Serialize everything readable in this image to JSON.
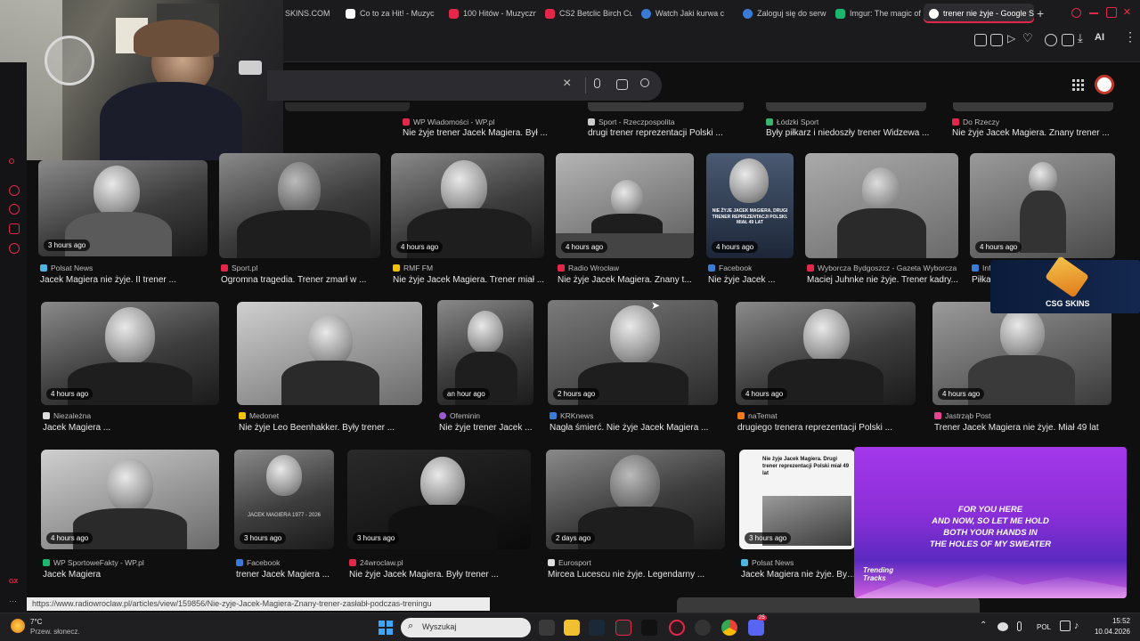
{
  "tabs": [
    {
      "label": "SKINS.COM",
      "color": "#3d3d3d"
    },
    {
      "label": "Co to za Hit! - Muzyc",
      "color": "#ffffff"
    },
    {
      "label": "100 Hitów - Muzyczn",
      "color": "#e3274a"
    },
    {
      "label": "CS2 Betclic Birch Cu",
      "color": "#e3274a"
    },
    {
      "label": "Watch Jaki kurwa c",
      "color": "#3a7bd5"
    },
    {
      "label": "Zaloguj się do serwi",
      "color": "#3a7bd5"
    },
    {
      "label": "Imgur: The magic of t",
      "color": "#1bb76e"
    },
    {
      "label": "trener nie żyje - Google Se",
      "color": "#ffffff"
    }
  ],
  "toolbar": {
    "ai_label": "AI"
  },
  "rail_labels": {
    "gx": "GX",
    "dots": "···"
  },
  "rows": [
    [
      {
        "source": "WP Wiadomości - WP.pl",
        "title": "Nie żyje trener Jacek Magiera. Był ...",
        "src_color": "#e3274a"
      },
      {
        "source": "Sport - Rzeczpospolita",
        "title": "drugi trener reprezentacji Polski ...",
        "src_color": "#cccccc"
      },
      {
        "source": "Łódzki Sport",
        "title": "Były piłkarz i niedoszły trener Widzewa ...",
        "src_color": "#3cb371"
      },
      {
        "source": "Do Rzeczy",
        "title": "Nie żyje Jacek Magiera. Znany trener ...",
        "src_color": "#e3274a"
      }
    ],
    [
      {
        "badge": "3 hours ago",
        "source": "Polsat News",
        "title": "Jacek Magiera nie żyje. II trener ...",
        "src_color": "#4fb3e0"
      },
      {
        "badge": "",
        "source": "Sport.pl",
        "title": "Ogromna tragedia. Trener zmarł w ...",
        "src_color": "#e3274a"
      },
      {
        "badge": "4 hours ago",
        "source": "RMF FM",
        "title": "Nie żyje Jacek Magiera. Trener miał ...",
        "src_color": "#f2c200"
      },
      {
        "badge": "4 hours ago",
        "source": "Radio Wrocław",
        "title": "Nie żyje Jacek Magiera. Znany t...",
        "src_color": "#e3274a"
      },
      {
        "badge": "4 hours ago",
        "source": "Facebook",
        "title": "Nie żyje Jacek ...",
        "src_color": "#3a7bd5",
        "overlay": "NIE ŻYJE JACEK MAGIERA, DRUGI TRENER REPREZENTACJI POLSKI. MIAŁ 49 LAT"
      },
      {
        "badge": "",
        "source": "Wyborcza Bydgoszcz - Gazeta Wyborcza",
        "title": "Maciej Juhnke nie żyje. Trener kadry...",
        "src_color": "#e3274a"
      },
      {
        "badge": "4 hours ago",
        "source": "Inf",
        "title": "Piłka",
        "src_color": "#3a7bd5"
      }
    ],
    [
      {
        "badge": "4 hours ago",
        "source": "Niezależna",
        "title": "Jacek Magiera ...",
        "src_color": "#dddddd"
      },
      {
        "badge": "",
        "source": "Medonet",
        "title": "Nie żyje Leo Beenhakker. Były trener ...",
        "src_color": "#f2c200"
      },
      {
        "badge": "an hour ago",
        "source": "Ofeminin",
        "title": "Nie żyje trener Jacek ...",
        "src_color": "#9b59d0"
      },
      {
        "badge": "2 hours ago",
        "source": "KRKnews",
        "title": "Nagła śmierć. Nie żyje Jacek Magiera ...",
        "src_color": "#3a7bd5"
      },
      {
        "badge": "4 hours ago",
        "source": "naTemat",
        "title": "drugiego trenera reprezentacji Polski ...",
        "src_color": "#f07a1a"
      },
      {
        "badge": "4 hours ago",
        "source": "Jastrząb Post",
        "title": "Trener Jacek Magiera nie żyje. Miał 49 lat",
        "src_color": "#e84393"
      }
    ],
    [
      {
        "badge": "4 hours ago",
        "source": "WP SportoweFakty - WP.pl",
        "title": "Jacek Magiera",
        "src_color": "#1bb76e"
      },
      {
        "badge": "3 hours ago",
        "source": "Facebook",
        "title": "trener Jacek Magiera ...",
        "src_color": "#3a7bd5",
        "overlay": "JACEK MAGIERA 1977 - 2026"
      },
      {
        "badge": "3 hours ago",
        "source": "24wroclaw.pl",
        "title": "Nie żyje Jacek Magiera. Były trener ...",
        "src_color": "#e3274a"
      },
      {
        "badge": "2 days ago",
        "source": "Eurosport",
        "title": "Mircea Lucescu nie żyje. Legendarny ...",
        "src_color": "#dddddd"
      },
      {
        "badge": "3 hours ago",
        "source": "Polsat News",
        "title": "Jacek Magiera nie żyje. Był tr",
        "src_color": "#4fb3e0",
        "overlay": "Nie żyje Jacek Magiera. Drugi trener reprezentacji Polski miał 49 lat"
      }
    ]
  ],
  "ads": {
    "csg_label": "CSG SKINS",
    "lyrics": [
      "FOR YOU HERE",
      "AND NOW, SO LET ME HOLD",
      "BOTH YOUR HANDS IN",
      "THE HOLES OF MY SWEATER"
    ],
    "lyrics_logo": "Trending Tracks"
  },
  "status_url": "https://www.radiowroclaw.pl/articles/view/159856/Nie-zyje-Jacek-Magiera-Znany-trener-zasłabł-podczas-treningu",
  "taskbar": {
    "weather_temp": "7°C",
    "weather_desc": "Przew. słonecz.",
    "search_placeholder": "Wyszukaj",
    "lang": "POL",
    "time": "15:52",
    "date": "10.04.2026",
    "discord_badge": "25"
  }
}
